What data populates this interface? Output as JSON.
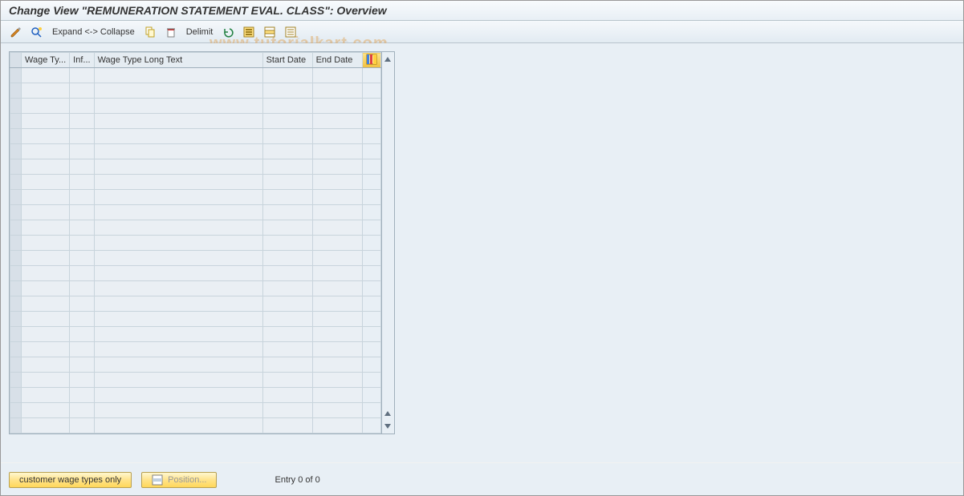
{
  "title": "Change View \"REMUNERATION STATEMENT EVAL. CLASS\": Overview",
  "toolbar": {
    "expand_collapse": "Expand <-> Collapse",
    "delimit": "Delimit"
  },
  "table": {
    "headers": {
      "wage_type": "Wage Ty...",
      "inf": "Inf...",
      "long_text": "Wage Type Long Text",
      "start_date": "Start Date",
      "end_date": "End Date"
    },
    "rows": [
      {},
      {},
      {},
      {},
      {},
      {},
      {},
      {},
      {},
      {},
      {},
      {},
      {},
      {},
      {},
      {},
      {},
      {},
      {},
      {},
      {},
      {},
      {},
      {}
    ]
  },
  "footer": {
    "customer_btn": "customer wage types only",
    "position_btn": "Position...",
    "entry_text": "Entry 0 of 0"
  },
  "watermark": "www.tutorialkart.com"
}
